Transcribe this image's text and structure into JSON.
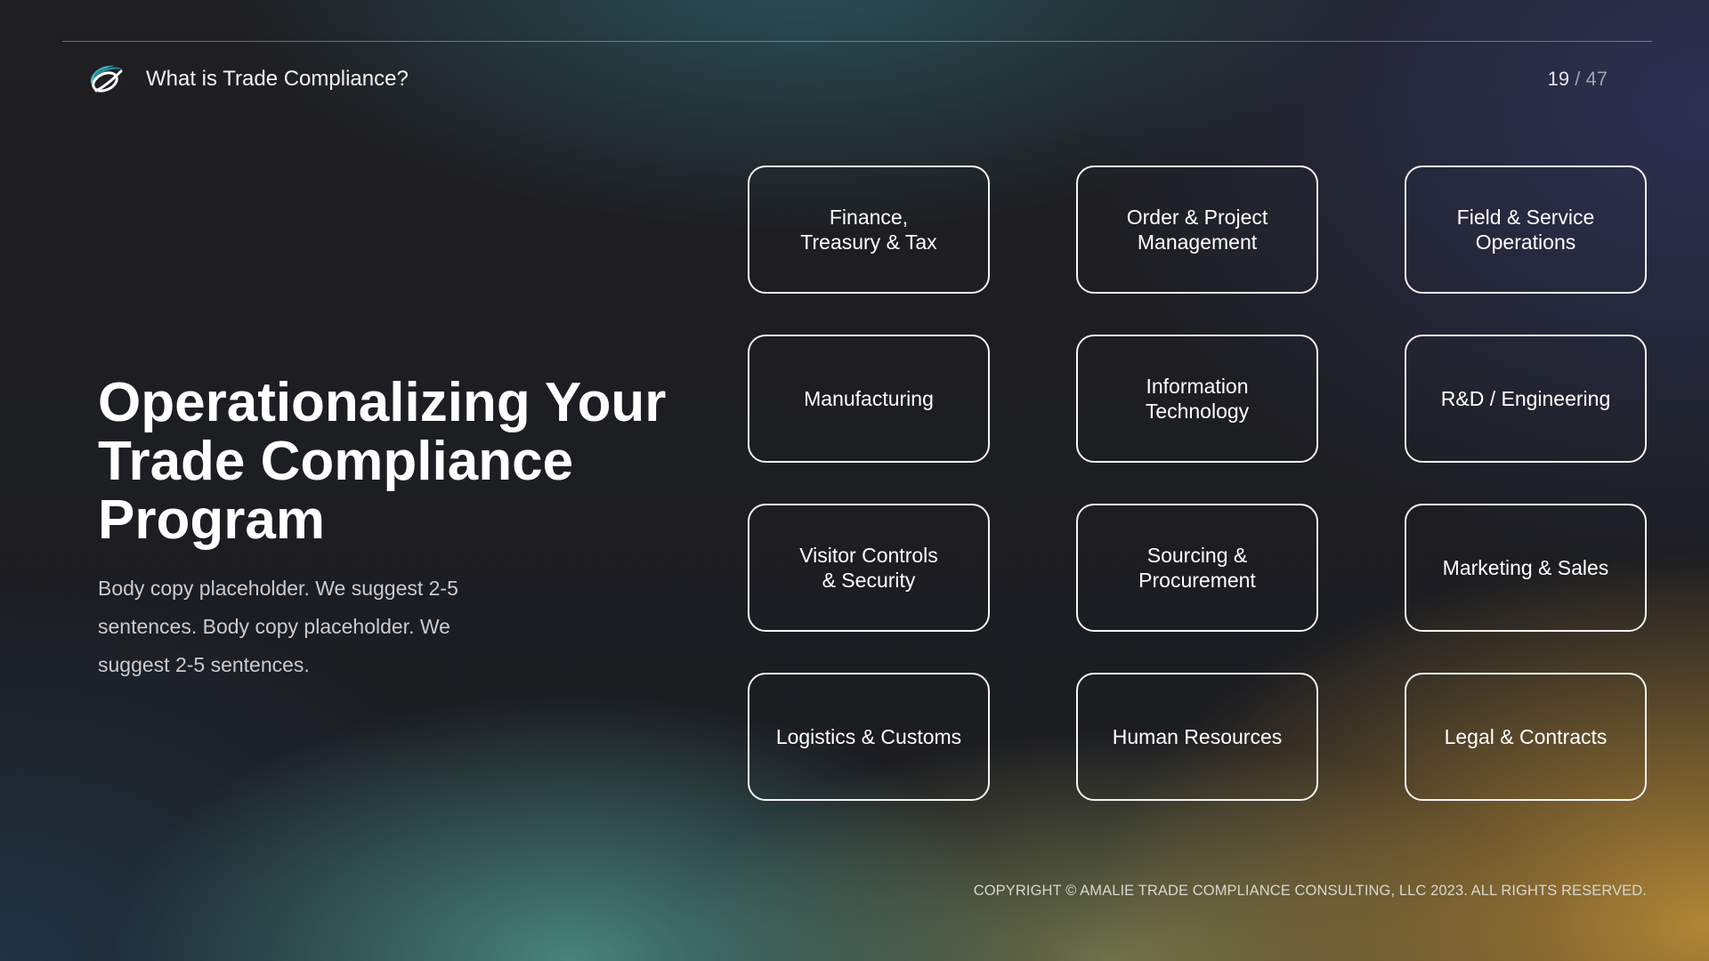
{
  "header": {
    "logo_icon": "swoosh-logo-icon",
    "title": "What is Trade Compliance?",
    "page": {
      "current": "19",
      "separator": "/",
      "total": "47"
    }
  },
  "main": {
    "title": "Operationalizing Your Trade Compliance Program",
    "body": "Body copy placeholder. We suggest 2-5 sentences. Body copy placeholder. We suggest 2-5 sentences."
  },
  "cards": [
    {
      "label": "Finance,\nTreasury & Tax"
    },
    {
      "label": "Order & Project\nManagement"
    },
    {
      "label": "Field & Service\nOperations"
    },
    {
      "label": "Manufacturing"
    },
    {
      "label": "Information\nTechnology"
    },
    {
      "label": "R&D / Engineering"
    },
    {
      "label": "Visitor Controls\n& Security"
    },
    {
      "label": "Sourcing &\nProcurement"
    },
    {
      "label": "Marketing & Sales"
    },
    {
      "label": "Logistics & Customs"
    },
    {
      "label": "Human Resources"
    },
    {
      "label": "Legal & Contracts"
    }
  ],
  "footer": {
    "copyright": "COPYRIGHT © AMALIE TRADE COMPLIANCE CONSULTING, LLC 2023.  ALL RIGHTS RESERVED."
  },
  "colors": {
    "logo_teal": "#3fb8c0",
    "card_border": "#f4f4f4",
    "accent_gold": "#b98c37"
  }
}
